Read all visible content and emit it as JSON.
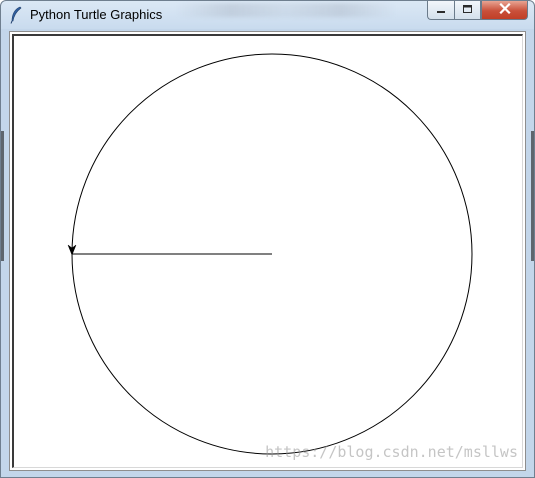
{
  "window": {
    "title": "Python Turtle Graphics",
    "icon": "feather-icon",
    "controls": {
      "minimize": "minimize-icon",
      "maximize": "maximize-icon",
      "close": "close-icon"
    }
  },
  "canvas": {
    "background": "#ffffff",
    "pen_color": "#000000",
    "drawing": {
      "shape": "circle",
      "radius": 200,
      "radius_line": "line from circle center to leftmost point",
      "turtle": "arrow"
    }
  },
  "watermark": "https://blog.csdn.net/msllws",
  "colors": {
    "close_button": "#c9503a",
    "title_bar": "#c9dbee"
  }
}
